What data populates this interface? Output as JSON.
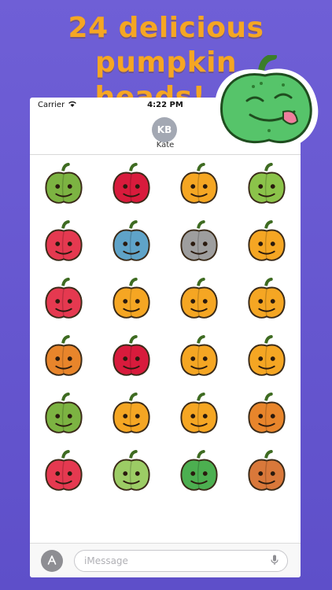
{
  "promo": {
    "headline_line1": "24 delicious pumpkin",
    "headline_line2": "heads!",
    "accent_color": "#f5a623",
    "background_color": "#6a5ad2"
  },
  "status_bar": {
    "carrier": "Carrier",
    "time": "4:22 PM",
    "wifi_icon": "wifi-icon"
  },
  "contact": {
    "initials": "KB",
    "name": "Kate"
  },
  "compose": {
    "placeholder": "iMessage",
    "app_button_icon": "app-store-icon",
    "mic_icon": "microphone-icon"
  },
  "stickers": [
    {
      "name": "scarecrow-green-pumpkin-sticker",
      "color": "#7cb342"
    },
    {
      "name": "angry-red-pumpkin-sticker",
      "color": "#d81b3c"
    },
    {
      "name": "cowboy-hat-pumpkin-sticker",
      "color": "#f5a623"
    },
    {
      "name": "googly-eyed-green-pumpkin-sticker",
      "color": "#8bc34a"
    },
    {
      "name": "grimacing-red-pumpkin-sticker",
      "color": "#e53950"
    },
    {
      "name": "zombie-blue-pumpkin-sticker",
      "color": "#5fa3c8"
    },
    {
      "name": "skull-pumpkin-sticker",
      "color": "#9e9e9e"
    },
    {
      "name": "robin-hood-pumpkin-sticker",
      "color": "#f5a623"
    },
    {
      "name": "mummy-red-pumpkin-sticker",
      "color": "#e53950"
    },
    {
      "name": "sad-orange-pumpkin-sticker",
      "color": "#f5a623"
    },
    {
      "name": "smirking-orange-pumpkin-sticker",
      "color": "#f5a623"
    },
    {
      "name": "crying-orange-pumpkin-sticker",
      "color": "#f5a623"
    },
    {
      "name": "medusa-pumpkin-sticker",
      "color": "#e8852b"
    },
    {
      "name": "blue-hat-red-pumpkin-sticker",
      "color": "#d81b3c"
    },
    {
      "name": "glasses-pumpkin-sticker",
      "color": "#f5a623"
    },
    {
      "name": "braces-glasses-pumpkin-sticker",
      "color": "#f5a623"
    },
    {
      "name": "stern-green-pumpkin-sticker",
      "color": "#7cb342"
    },
    {
      "name": "tongue-out-pumpkin-sticker",
      "color": "#f5a623"
    },
    {
      "name": "headphones-pumpkin-sticker",
      "color": "#f5a623"
    },
    {
      "name": "disguise-hat-pumpkin-sticker",
      "color": "#e8852b"
    },
    {
      "name": "shy-red-pumpkin-sticker",
      "color": "#e53950"
    },
    {
      "name": "rotten-zombie-pumpkin-sticker",
      "color": "#9ccc65"
    },
    {
      "name": "licking-green-pumpkin-sticker",
      "color": "#4caf50"
    },
    {
      "name": "viking-pumpkin-sticker",
      "color": "#d9783a"
    }
  ],
  "hero_sticker": {
    "name": "hero-licking-green-pumpkin-sticker",
    "color": "#56c46a"
  }
}
